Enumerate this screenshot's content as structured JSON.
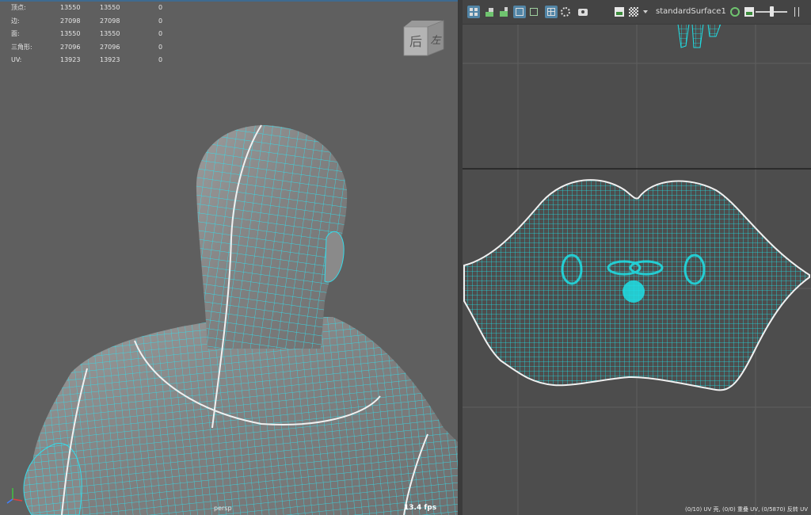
{
  "left_viewport": {
    "camera_label": "persp",
    "fps": "13.4 fps",
    "viewcube": {
      "face_back": "后",
      "face_left": "左"
    },
    "stats": [
      {
        "label": "顶点:",
        "v1": "13550",
        "v2": "13550",
        "v3": "0"
      },
      {
        "label": "边:",
        "v1": "27098",
        "v2": "27098",
        "v3": "0"
      },
      {
        "label": "面:",
        "v1": "13550",
        "v2": "13550",
        "v3": "0"
      },
      {
        "label": "三角形:",
        "v1": "27096",
        "v2": "27096",
        "v3": "0"
      },
      {
        "label": "UV:",
        "v1": "13923",
        "v2": "13923",
        "v3": "0"
      }
    ]
  },
  "right_panel": {
    "material_name": "standardSurface1",
    "status_text": "(0/10) UV 壳, (0/0) 重叠 UV, (0/5870) 反转 UV",
    "toolbar_icons": [
      "grid-toggle-icon",
      "texture-icon",
      "shaded-icon",
      "frame-icon",
      "frame-all-icon",
      "grid-icon",
      "checker-icon",
      "snapshot-icon",
      "image-icon",
      "checker-pattern-icon",
      "dropdown-icon",
      "color-management-icon",
      "image-display-icon",
      "exposure-slider",
      "more-icon"
    ]
  },
  "colors": {
    "wire": "#34dcea",
    "border_edge": "#f0f0f0",
    "viewport_bg": "#5f5f5f",
    "uv_bg": "#4d4d4d",
    "accent": "#5285a6"
  }
}
